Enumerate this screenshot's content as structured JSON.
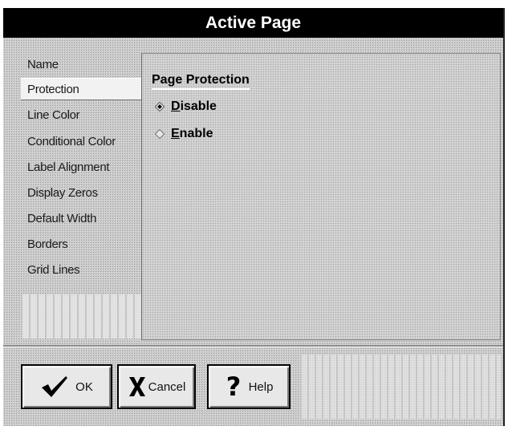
{
  "window": {
    "title": "Active Page"
  },
  "nav": {
    "items": [
      {
        "label": "Name"
      },
      {
        "label": "Protection"
      },
      {
        "label": "Line Color"
      },
      {
        "label": "Conditional Color"
      },
      {
        "label": "Label Alignment"
      },
      {
        "label": "Display Zeros"
      },
      {
        "label": "Default Width"
      },
      {
        "label": "Borders"
      },
      {
        "label": "Grid Lines"
      }
    ],
    "selected": "Protection"
  },
  "panel": {
    "group_title": "Page Protection",
    "options": [
      {
        "underlined": "D",
        "rest": "isable",
        "checked": true
      },
      {
        "underlined": "E",
        "rest": "nable",
        "checked": false
      }
    ]
  },
  "buttons": {
    "ok_label": "OK",
    "cancel_label": "Cancel",
    "help_label": "Help",
    "ok_icon": "checkmark-icon",
    "cancel_icon": "x-icon",
    "help_icon": "question-icon"
  }
}
